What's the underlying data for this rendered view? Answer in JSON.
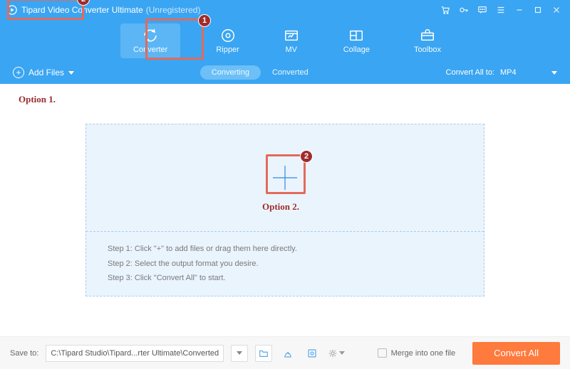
{
  "title": {
    "product": "Tipard Video Converter Ultimate",
    "registration": "(Unregistered)"
  },
  "nav": {
    "items": [
      {
        "label": "Converter",
        "active": true
      },
      {
        "label": "Ripper"
      },
      {
        "label": "MV"
      },
      {
        "label": "Collage"
      },
      {
        "label": "Toolbox"
      }
    ]
  },
  "subbar": {
    "add_files_label": "Add Files",
    "tabs": {
      "converting": "Converting",
      "converted": "Converted"
    },
    "convert_all_to_label": "Convert All to:",
    "format": "MP4"
  },
  "dropzone": {
    "steps": [
      "Step 1: Click \"+\" to add files or drag them here directly.",
      "Step 2: Select the output format you desire.",
      "Step 3: Click \"Convert All\" to start."
    ]
  },
  "bottombar": {
    "save_to_label": "Save to:",
    "save_to_path": "C:\\Tipard Studio\\Tipard...rter Ultimate\\Converted",
    "merge_label": "Merge into one file",
    "convert_all_label": "Convert All"
  },
  "annotations": {
    "badge1": "1",
    "badge2": "2",
    "option1": "Option 1.",
    "option2": "Option 2."
  }
}
